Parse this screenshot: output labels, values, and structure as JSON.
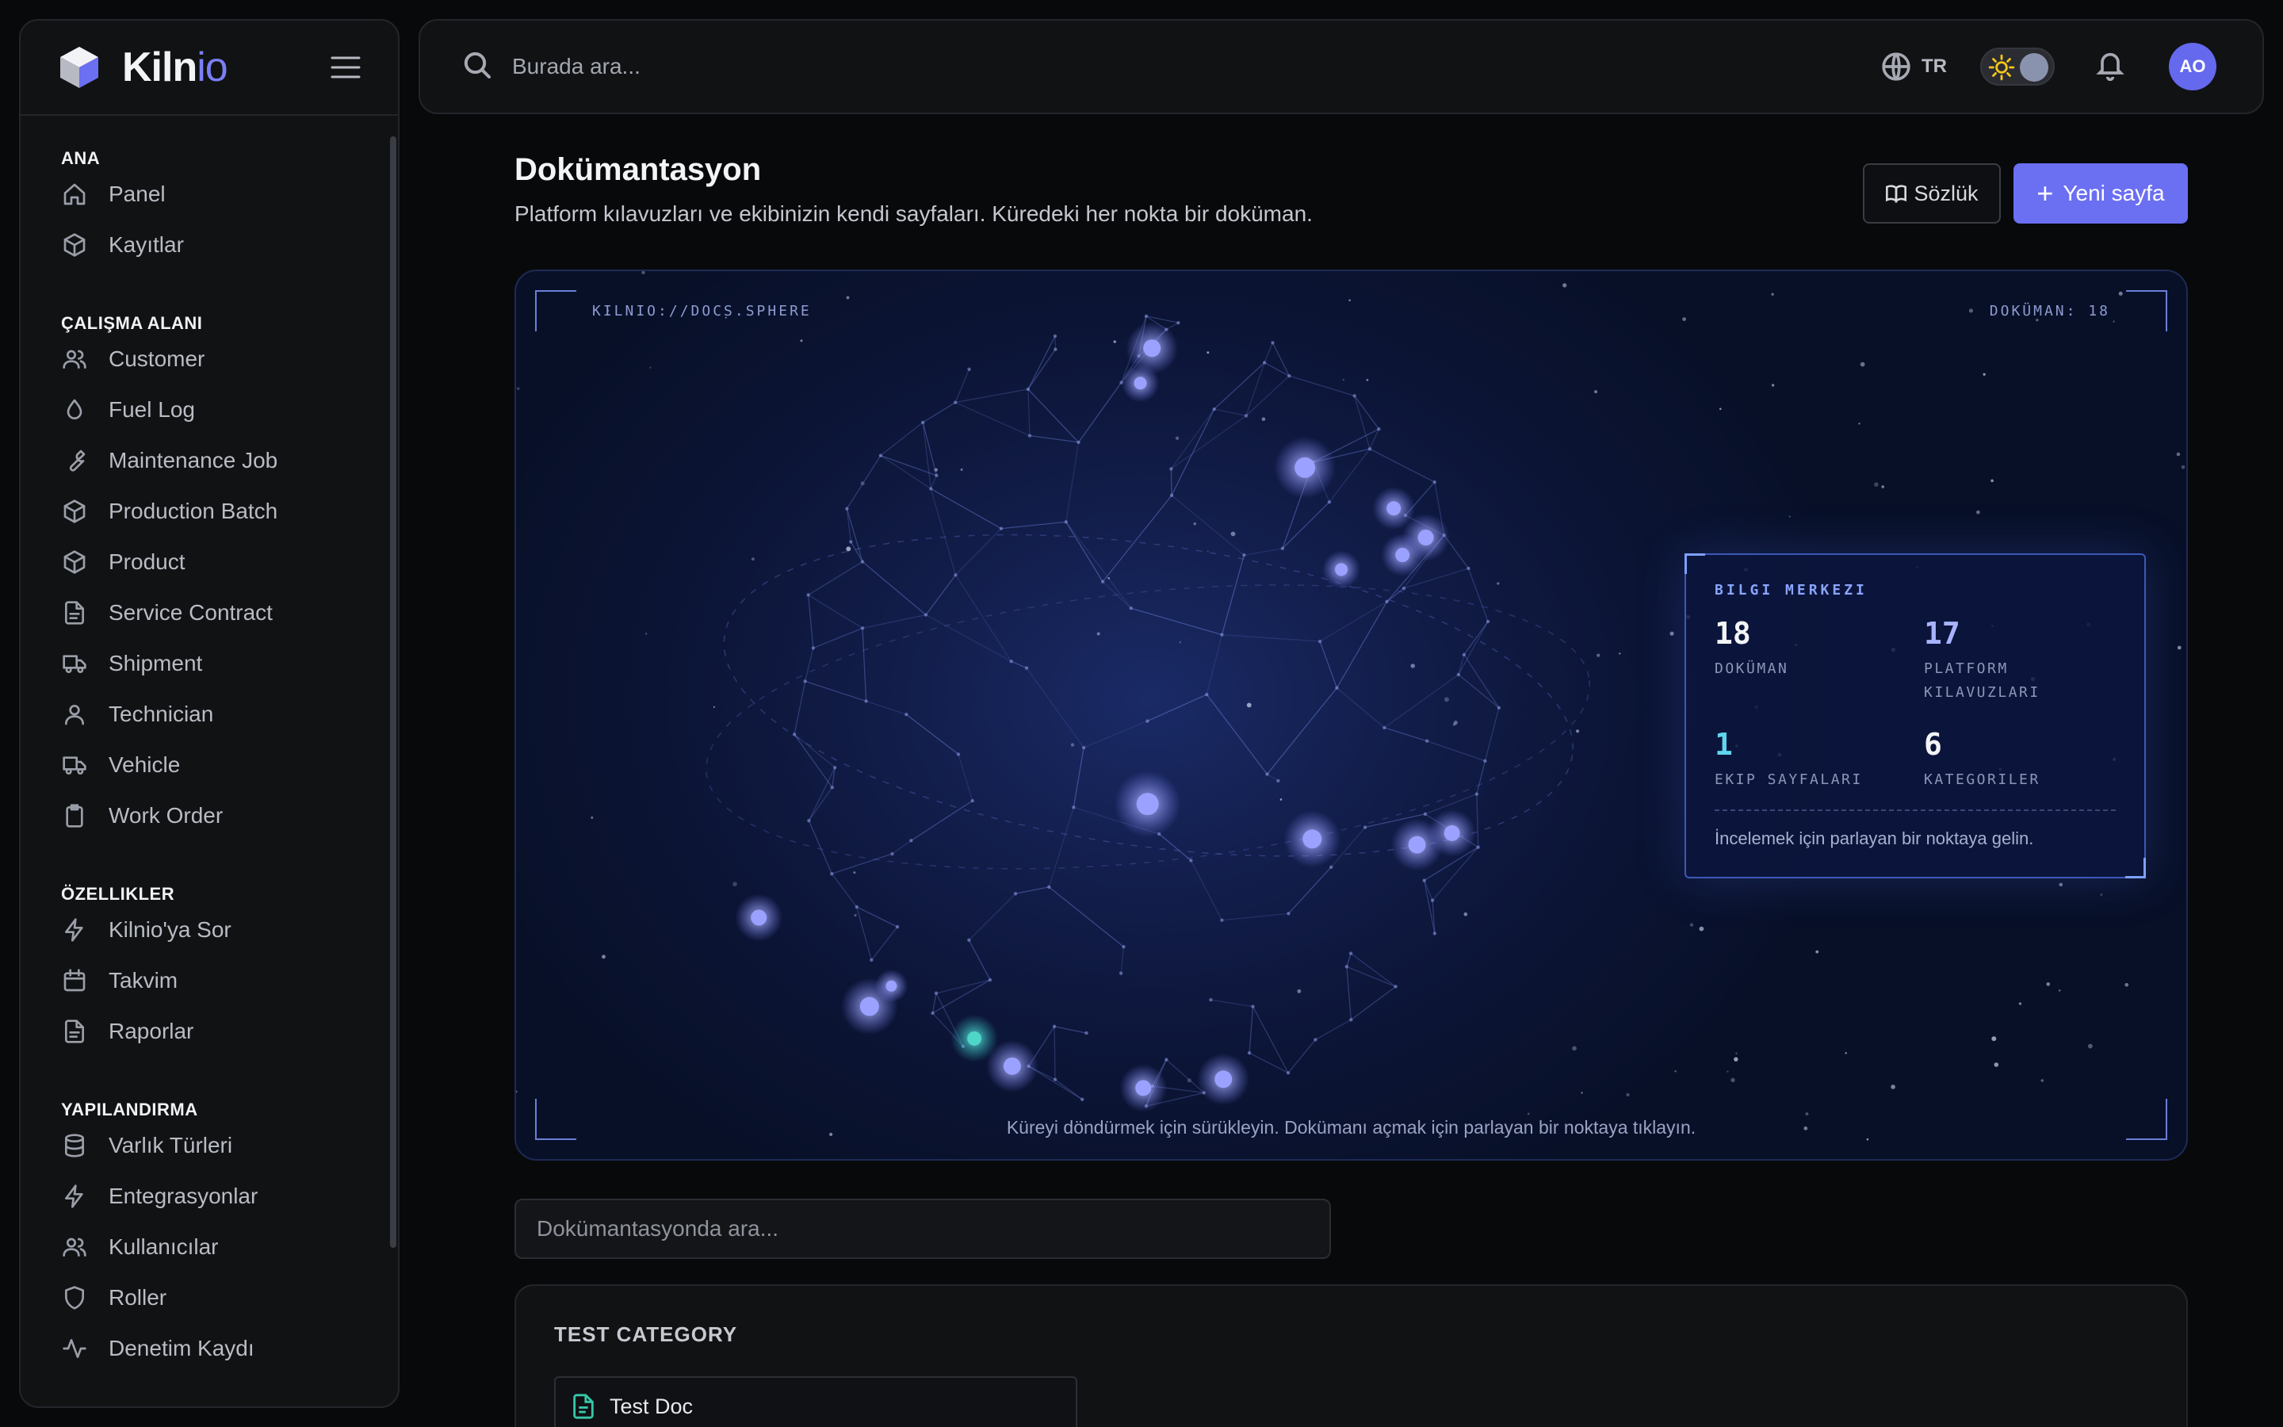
{
  "brand": {
    "name_main": "Kiln",
    "name_accent": "io"
  },
  "topbar": {
    "search_placeholder": "Burada ara...",
    "language": "TR",
    "avatar_initials": "AO"
  },
  "sidebar": {
    "sections": [
      {
        "title": "ANA",
        "items": [
          {
            "label": "Panel",
            "icon": "home-icon"
          },
          {
            "label": "Kayıtlar",
            "icon": "box-icon"
          }
        ]
      },
      {
        "title": "ÇALIŞMA ALANI",
        "items": [
          {
            "label": "Customer",
            "icon": "users-icon"
          },
          {
            "label": "Fuel Log",
            "icon": "droplet-icon"
          },
          {
            "label": "Maintenance Job",
            "icon": "wrench-icon"
          },
          {
            "label": "Production Batch",
            "icon": "box-icon"
          },
          {
            "label": "Product",
            "icon": "box-icon"
          },
          {
            "label": "Service Contract",
            "icon": "file-icon"
          },
          {
            "label": "Shipment",
            "icon": "truck-icon"
          },
          {
            "label": "Technician",
            "icon": "user-icon"
          },
          {
            "label": "Vehicle",
            "icon": "truck-icon"
          },
          {
            "label": "Work Order",
            "icon": "clipboard-icon"
          }
        ]
      },
      {
        "title": "ÖZELLIKLER",
        "items": [
          {
            "label": "Kilnio'ya Sor",
            "icon": "bolt-icon"
          },
          {
            "label": "Takvim",
            "icon": "calendar-icon"
          },
          {
            "label": "Raporlar",
            "icon": "file-icon"
          }
        ]
      },
      {
        "title": "YAPILANDIRMA",
        "items": [
          {
            "label": "Varlık Türleri",
            "icon": "database-icon"
          },
          {
            "label": "Entegrasyonlar",
            "icon": "bolt-icon"
          },
          {
            "label": "Kullanıcılar",
            "icon": "users-icon"
          },
          {
            "label": "Roller",
            "icon": "shield-icon"
          },
          {
            "label": "Denetim Kaydı",
            "icon": "activity-icon"
          }
        ]
      }
    ]
  },
  "header": {
    "title": "Dokümantasyon",
    "subtitle": "Platform kılavuzları ve ekibinizin kendi sayfaları. Küredeki her nokta bir doküman.",
    "glossary_label": "Sözlük",
    "new_page_label": "Yeni sayfa"
  },
  "sphere": {
    "hud_left": "KILNIO://DOCS.SPHERE",
    "hud_right": "DOKÜMAN: 18",
    "hint": "Küreyi döndürmek için sürükleyin. Dokümanı açmak için parlayan bir noktaya tıklayın.",
    "info": {
      "title": "BILGI MERKEZI",
      "stats": [
        {
          "value": "18",
          "label": "DOKÜMAN",
          "color": "#f3f4f6"
        },
        {
          "value": "17",
          "label": "PLATFORM KILAVUZLARI",
          "color": "#a7b3ff"
        },
        {
          "value": "1",
          "label": "EKIP SAYFALARI",
          "color": "#5fd6ee"
        },
        {
          "value": "6",
          "label": "KATEGORILER",
          "color": "#f3f4f6"
        }
      ],
      "footer": "İncelemek için parlayan bir noktaya gelin."
    }
  },
  "docs": {
    "search_placeholder": "Dokümantasyonda ara...",
    "categories": [
      {
        "title": "TEST CATEGORY",
        "items": [
          {
            "label": "Test Doc",
            "icon": "file-icon"
          }
        ]
      }
    ]
  }
}
